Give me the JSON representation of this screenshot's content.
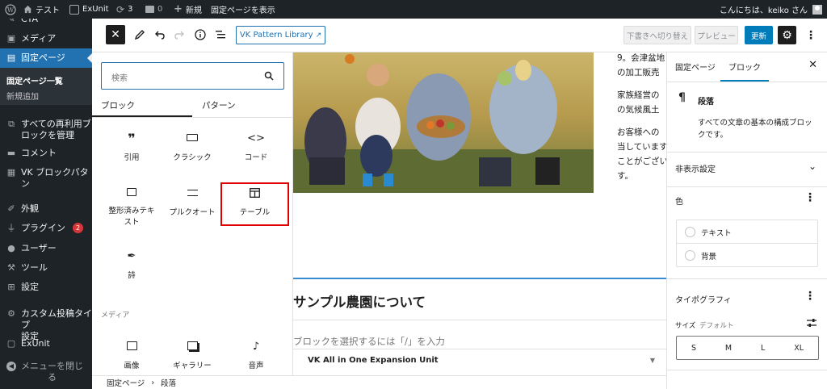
{
  "admin_bar": {
    "site_name": "テスト",
    "exunit": "ExUnit",
    "updates_count": "3",
    "comments_count": "0",
    "new": "新規",
    "view_page": "固定ページを表示",
    "greeting": "こんにちは、keiko さん"
  },
  "sidebar": {
    "top_partial": "CTA",
    "media": "メディア",
    "pages": "固定ページ",
    "pages_list": "固定ページ一覧",
    "add_new": "新規追加",
    "reusable_line1": "すべての再利用ブ",
    "reusable_line2": "ロックを管理",
    "comments": "コメント",
    "vk_patterns": "VK ブロックパタン",
    "appearance": "外観",
    "plugins": "プラグイン",
    "plugins_badge": "2",
    "users": "ユーザー",
    "tools": "ツール",
    "settings": "設定",
    "custom_post_line1": "カスタム投稿タイプ",
    "custom_post_line2": "設定",
    "exunit": "ExUnit",
    "collapse_line1": "メニューを閉じ",
    "collapse_line2": "る"
  },
  "toolbar": {
    "vk_pattern_library": "VK Pattern Library",
    "save_draft": "下書きへ切り替え",
    "preview": "プレビュー",
    "update": "更新"
  },
  "inserter": {
    "search_placeholder": "検索",
    "tab_blocks": "ブロック",
    "tab_patterns": "パターン",
    "blocks": [
      {
        "label": "引用",
        "icon": "quote-icon"
      },
      {
        "label": "クラシック",
        "icon": "keyboard-icon"
      },
      {
        "label": "コード",
        "icon": "code-icon"
      },
      {
        "label": "整形済みテキスト",
        "icon": "preformatted-icon"
      },
      {
        "label": "プルクオート",
        "icon": "pullquote-icon"
      },
      {
        "label": "テーブル",
        "icon": "table-icon"
      },
      {
        "label": "詩",
        "icon": "verse-icon"
      }
    ],
    "media_heading": "メディア",
    "media_blocks": [
      {
        "label": "画像",
        "icon": "image-icon"
      },
      {
        "label": "ギャラリー",
        "icon": "gallery-icon"
      },
      {
        "label": "音声",
        "icon": "audio-icon"
      }
    ],
    "highlight_color": "#e00000"
  },
  "canvas": {
    "text_lines": [
      "9。会津盆地",
      "の加工販売",
      "家族経営の",
      "の気候風土",
      "お客様への",
      "当しています",
      "ことがござい",
      "す。"
    ],
    "heading": "サンプル農園について",
    "appender": "ブロックを選択するには「/」を入力",
    "vk_unit": "VK All in One Expansion Unit"
  },
  "settings": {
    "tab_page": "固定ページ",
    "tab_block": "ブロック",
    "block_name": "段落",
    "block_description": "すべての文章の基本の構成ブロックです。",
    "hidden_settings": "非表示設定",
    "color_title": "色",
    "color_text": "テキスト",
    "color_background": "背景",
    "typography_title": "タイポグラフィ",
    "size_label": "サイズ",
    "size_default": "デフォルト",
    "sizes": [
      "S",
      "M",
      "L",
      "XL"
    ]
  },
  "breadcrumb": {
    "item1": "固定ページ",
    "separator": "›",
    "item2": "段落"
  },
  "colors": {
    "admin_dark": "#1d2327",
    "accent_blue": "#2271b1",
    "wp_blue": "#007cba"
  }
}
